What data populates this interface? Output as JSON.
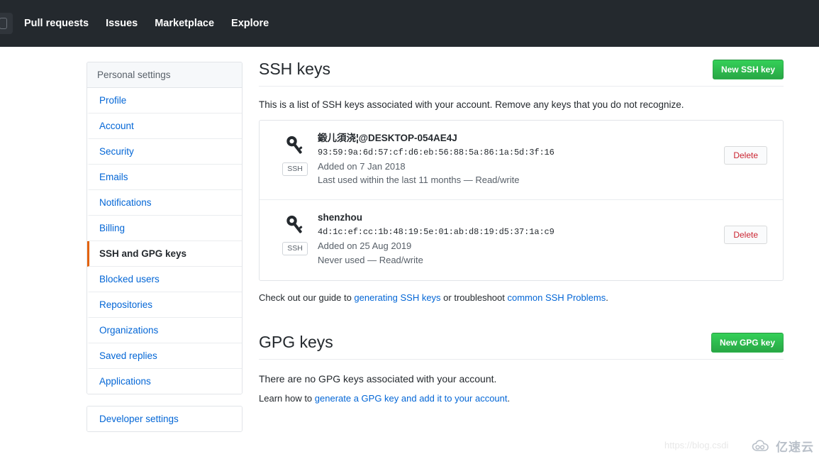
{
  "topnav": {
    "logo_icon": "github-mark-icon",
    "links": [
      {
        "label": "Pull requests"
      },
      {
        "label": "Issues"
      },
      {
        "label": "Marketplace"
      },
      {
        "label": "Explore"
      }
    ]
  },
  "sidebar": {
    "header": "Personal settings",
    "items": [
      {
        "label": "Profile",
        "active": false
      },
      {
        "label": "Account",
        "active": false
      },
      {
        "label": "Security",
        "active": false
      },
      {
        "label": "Emails",
        "active": false
      },
      {
        "label": "Notifications",
        "active": false
      },
      {
        "label": "Billing",
        "active": false
      },
      {
        "label": "SSH and GPG keys",
        "active": true
      },
      {
        "label": "Blocked users",
        "active": false
      },
      {
        "label": "Repositories",
        "active": false
      },
      {
        "label": "Organizations",
        "active": false
      },
      {
        "label": "Saved replies",
        "active": false
      },
      {
        "label": "Applications",
        "active": false
      }
    ],
    "developer_settings": "Developer settings",
    "active_marker_color": "#e36209"
  },
  "ssh_section": {
    "title": "SSH keys",
    "new_button": "New SSH key",
    "lead": "This is a list of SSH keys associated with your account. Remove any keys that you do not recognize.",
    "keys": [
      {
        "icon": "key-icon",
        "badge": "SSH",
        "title": "鍛儿須浇¦@DESKTOP-054AE4J",
        "fingerprint": "93:59:9a:6d:57:cf:d6:eb:56:88:5a:86:1a:5d:3f:16",
        "added": "Added on 7 Jan 2018",
        "last_used": "Last used within the last 11 months — Read/write",
        "delete_label": "Delete"
      },
      {
        "icon": "key-icon",
        "badge": "SSH",
        "title": "shenzhou",
        "fingerprint": "4d:1c:ef:cc:1b:48:19:5e:01:ab:d8:19:d5:37:1a:c9",
        "added": "Added on 25 Aug 2019",
        "last_used": "Never used — Read/write",
        "delete_label": "Delete"
      }
    ],
    "note": {
      "prefix": "Check out our guide to ",
      "link1": "generating SSH keys",
      "middle": " or troubleshoot ",
      "link2": "common SSH Problems",
      "suffix": "."
    }
  },
  "gpg_section": {
    "title": "GPG keys",
    "new_button": "New GPG key",
    "empty": "There are no GPG keys associated with your account.",
    "learn": {
      "prefix": "Learn how to ",
      "link": "generate a GPG key and add it to your account",
      "suffix": "."
    }
  },
  "watermarks": {
    "url": "https://blog.csdi",
    "logo_text": "亿速云",
    "logo_icon": "cloud-icon"
  },
  "colors": {
    "nav_bg": "#24292e",
    "link": "#0366d6",
    "green_button": "#28a745",
    "delete_red": "#cb2431",
    "accent_orange": "#e36209"
  }
}
